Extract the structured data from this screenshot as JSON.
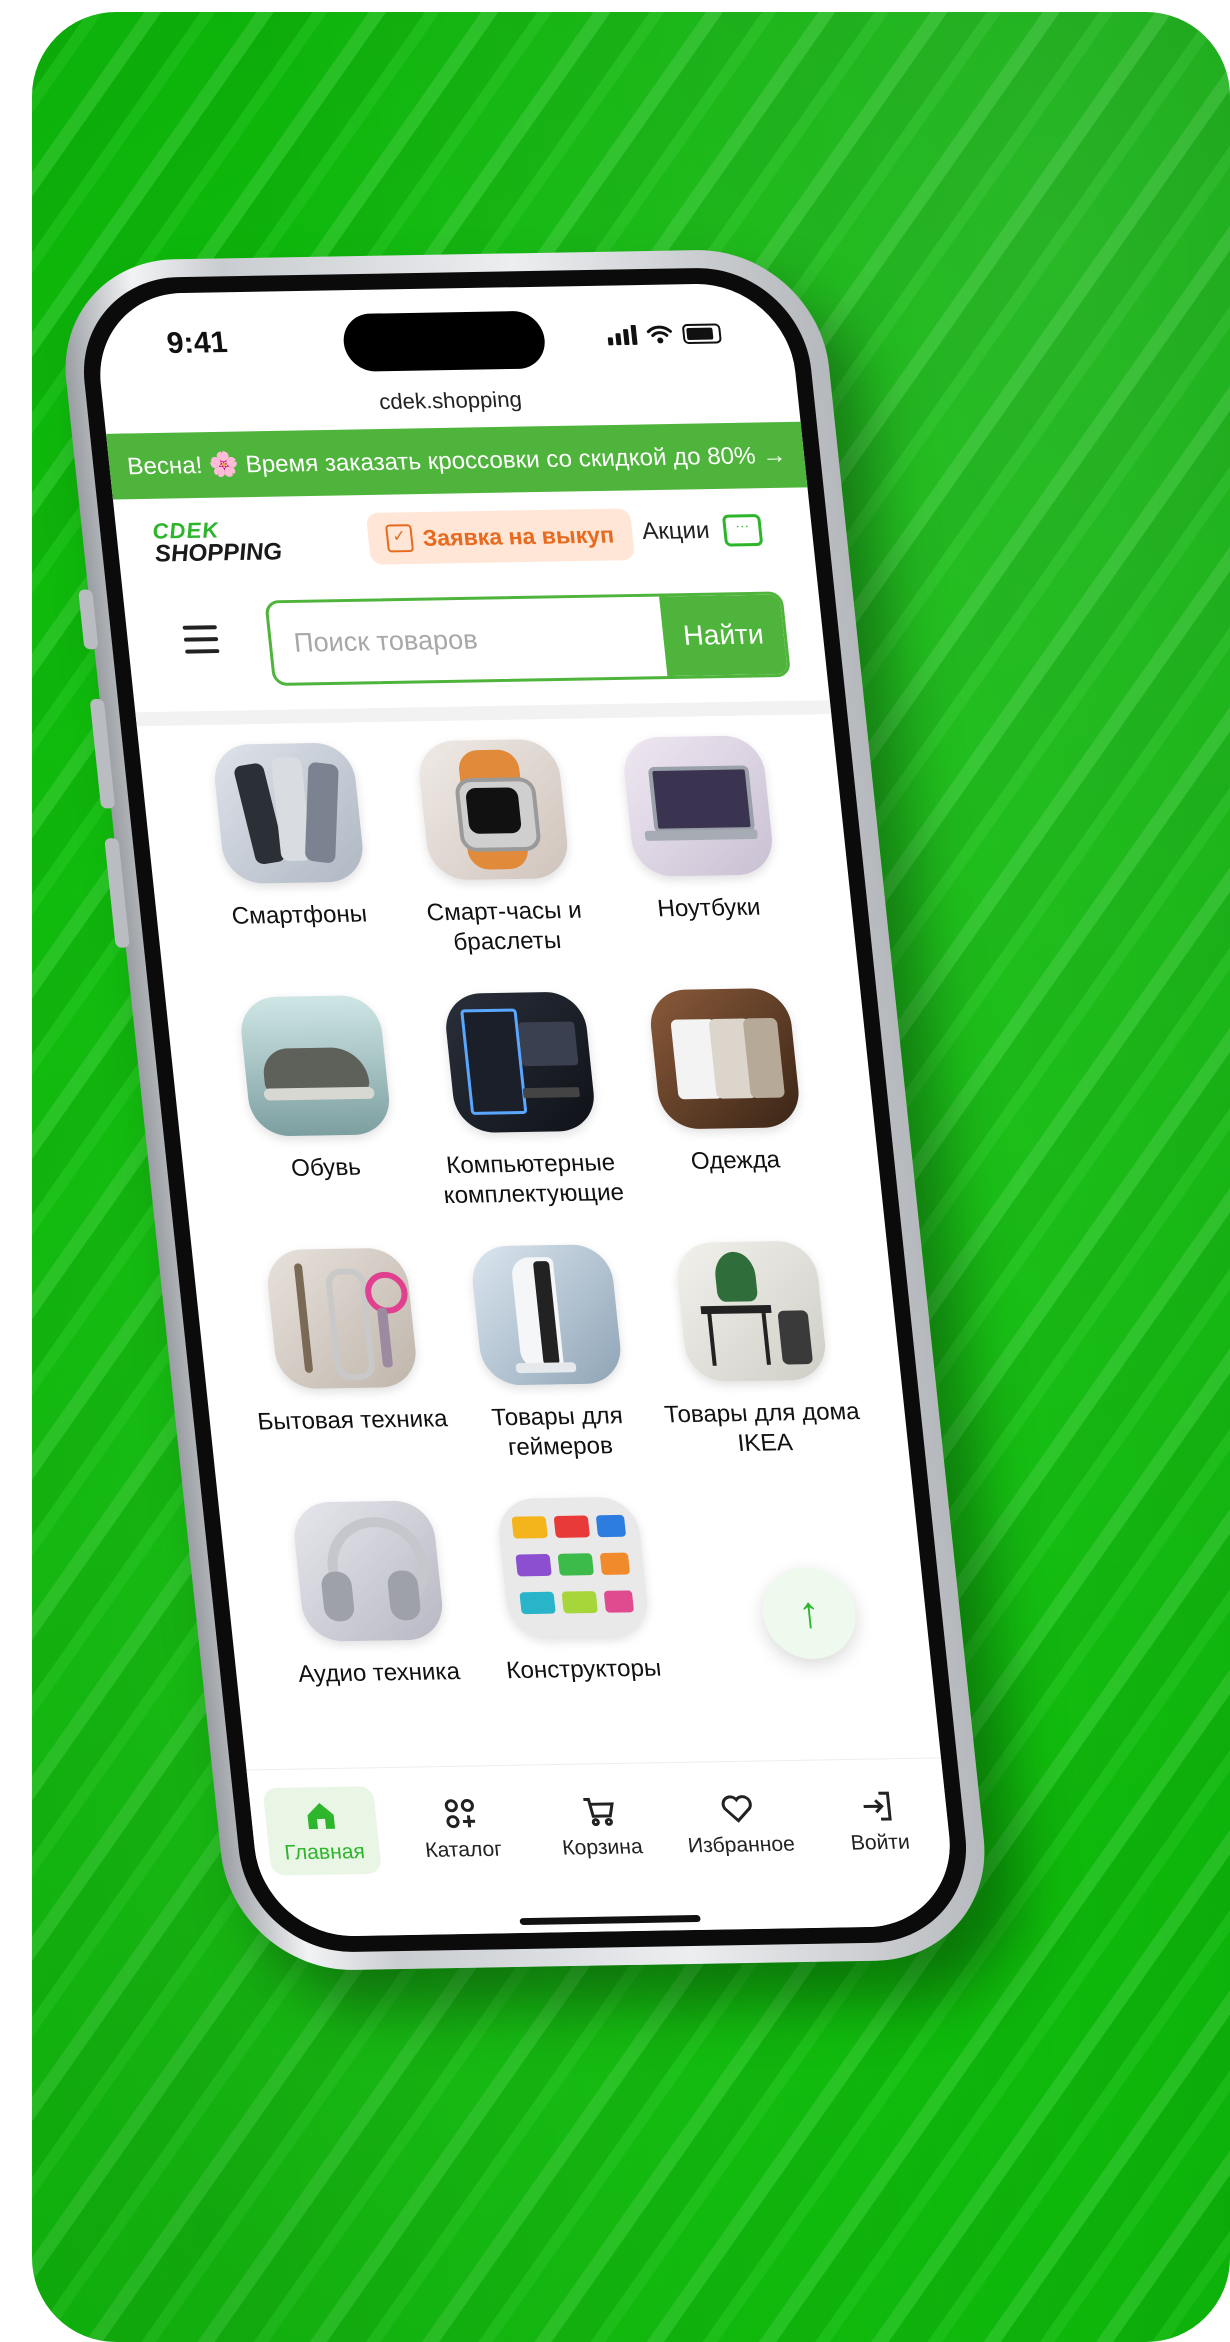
{
  "status": {
    "time": "9:41"
  },
  "browser": {
    "url": "cdek.shopping"
  },
  "promo_banner": {
    "text": "Весна! 🌸 Время заказать кроссовки со скидкой до 80% →"
  },
  "header": {
    "logo_line1": "CDEK",
    "logo_line2": "SHOPPING",
    "buyout_label": "Заявка на выкуп",
    "promos_label": "Акции"
  },
  "search": {
    "placeholder": "Поиск товаров",
    "value": "",
    "button_label": "Найти"
  },
  "categories": [
    {
      "label": "Смартфоны",
      "icon": "smartphones-image"
    },
    {
      "label": "Смарт-часы и браслеты",
      "icon": "smartwatch-image"
    },
    {
      "label": "Ноутбуки",
      "icon": "laptop-image"
    },
    {
      "label": "Обувь",
      "icon": "sneaker-image"
    },
    {
      "label": "Компьютерные комплектующие",
      "icon": "pc-image"
    },
    {
      "label": "Одежда",
      "icon": "tshirts-image"
    },
    {
      "label": "Бытовая техника",
      "icon": "appliances-image"
    },
    {
      "label": "Товары для геймеров",
      "icon": "console-image"
    },
    {
      "label": "Товары для дома IKEA",
      "icon": "home-decor-image"
    },
    {
      "label": "Аудио техника",
      "icon": "headphones-image"
    },
    {
      "label": "Конструкторы",
      "icon": "lego-image"
    }
  ],
  "tabbar": [
    {
      "label": "Главная",
      "icon": "home-icon",
      "active": true
    },
    {
      "label": "Каталог",
      "icon": "catalog-icon",
      "active": false
    },
    {
      "label": "Корзина",
      "icon": "cart-icon",
      "active": false
    },
    {
      "label": "Избранное",
      "icon": "heart-icon",
      "active": false
    },
    {
      "label": "Войти",
      "icon": "login-icon",
      "active": false
    }
  ],
  "colors": {
    "brand_green": "#4fb43b",
    "accent_orange": "#e86a1f",
    "background_green": "#10c40c"
  }
}
